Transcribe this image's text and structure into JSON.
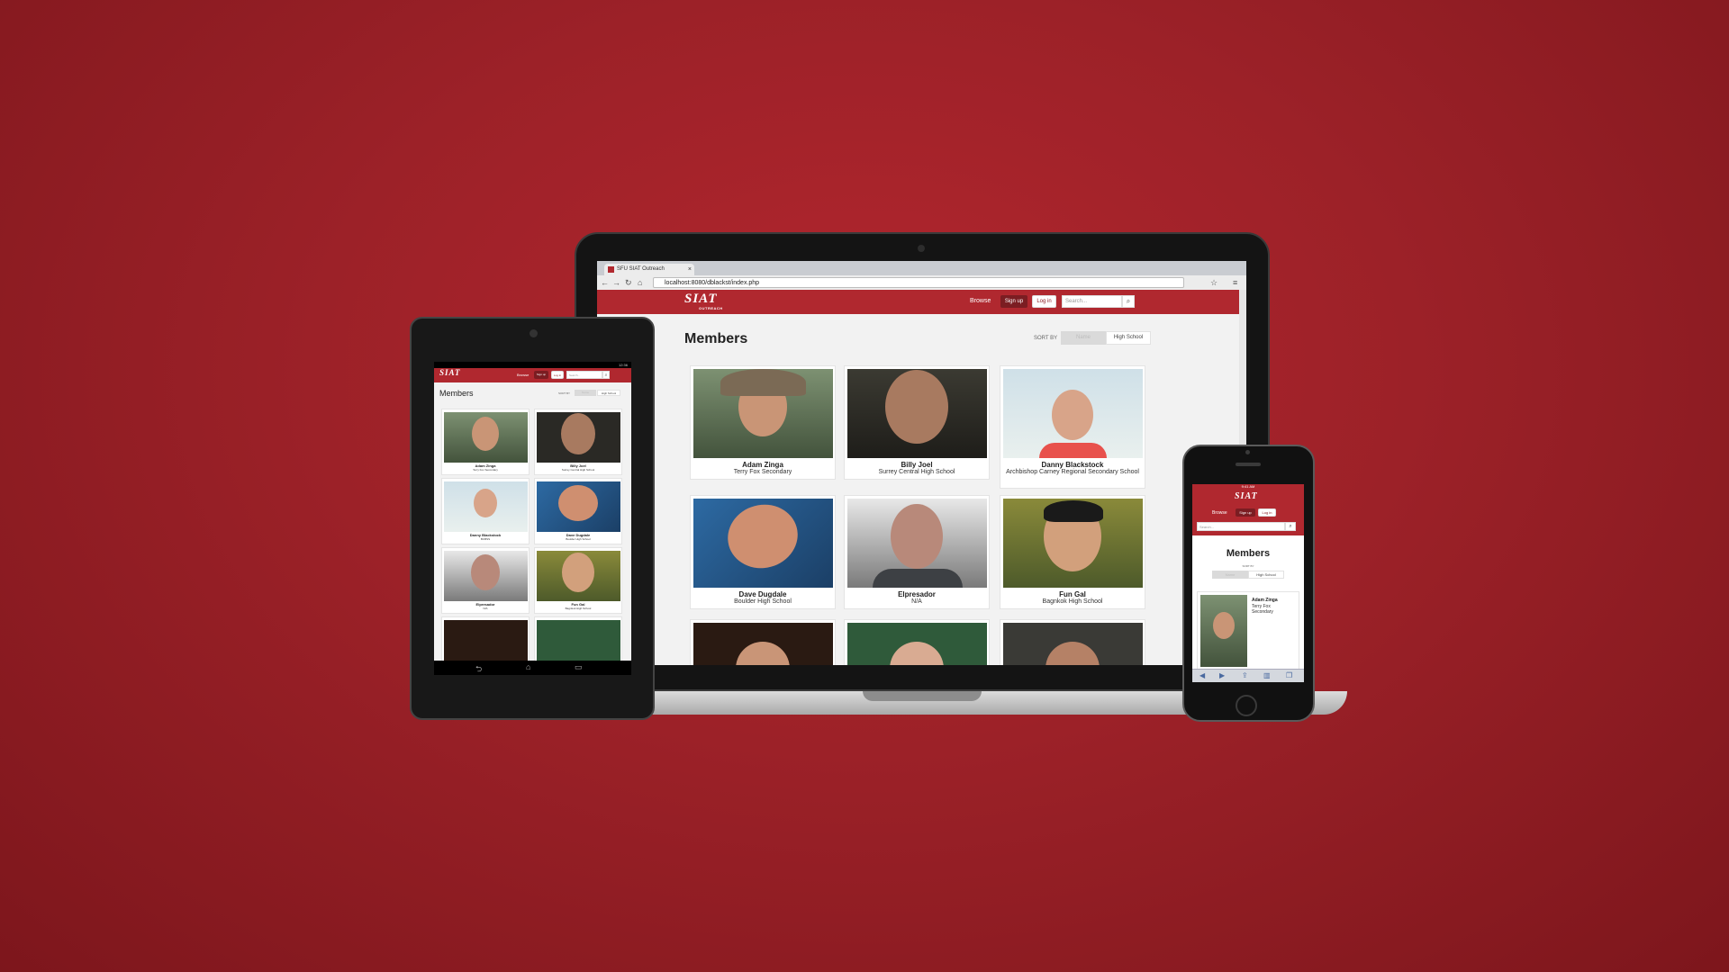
{
  "browser": {
    "tab_title": "SFU SIAT Outreach",
    "tab_close": "×",
    "url": "localhost:8080/dblackst/index.php",
    "back_glyph": "←",
    "forward_glyph": "→",
    "reload_glyph": "↻",
    "home_glyph": "⌂",
    "star_glyph": "☆",
    "menu_glyph": "≡"
  },
  "site": {
    "logo_text": "SIAT",
    "logo_sub": "OUTREACH",
    "nav_browse": "Browse",
    "nav_signup": "Sign up",
    "nav_login": "Log in",
    "search_placeholder": "Search...",
    "search_icon": "⌕",
    "page_title": "Members",
    "sort_label": "SORT BY",
    "sort_name": "Name",
    "sort_highschool": "High School"
  },
  "members": [
    {
      "name": "Adam Zinga",
      "school": "Terry Fox Secondary"
    },
    {
      "name": "Billy Joel",
      "school": "Surrey Central High School"
    },
    {
      "name": "Danny Blackstock",
      "school": "Archbishop Carney Regional Secondary School"
    },
    {
      "name": "Dave Dugdale",
      "school": "Boulder High School"
    },
    {
      "name": "Elpresador",
      "school": "N/A"
    },
    {
      "name": "Fun Gal",
      "school": "Bagnkok High School"
    }
  ],
  "tablet": {
    "status_time": "12:36",
    "nav_back": "⮌",
    "nav_home": "⌂",
    "nav_recent": "▭",
    "members": [
      {
        "name": "Adam Zinga",
        "school": "Terry Fox Secondary"
      },
      {
        "name": "Billy Joel",
        "school": "Surrey Central High School"
      },
      {
        "name": "Danny Blackstock",
        "school": "BCBSS"
      },
      {
        "name": "Dave Dugdale",
        "school": "Boulder High School"
      },
      {
        "name": "Elpresador",
        "school": "N/A"
      },
      {
        "name": "Fun Gal",
        "school": "Bagnkok High School"
      }
    ]
  },
  "phone": {
    "status_time": "9:41 AM",
    "member": {
      "name": "Adam Zinga",
      "school_line1": "Terry Fox",
      "school_line2": "Secondary"
    },
    "tb_back": "◀",
    "tb_forward": "▶",
    "tb_share": "⇪",
    "tb_book": "▥",
    "tb_tabs": "❐"
  },
  "colors": {
    "background": "#9c2128",
    "header_red": "#b0282f",
    "signup_dark": "#7b1d22"
  }
}
